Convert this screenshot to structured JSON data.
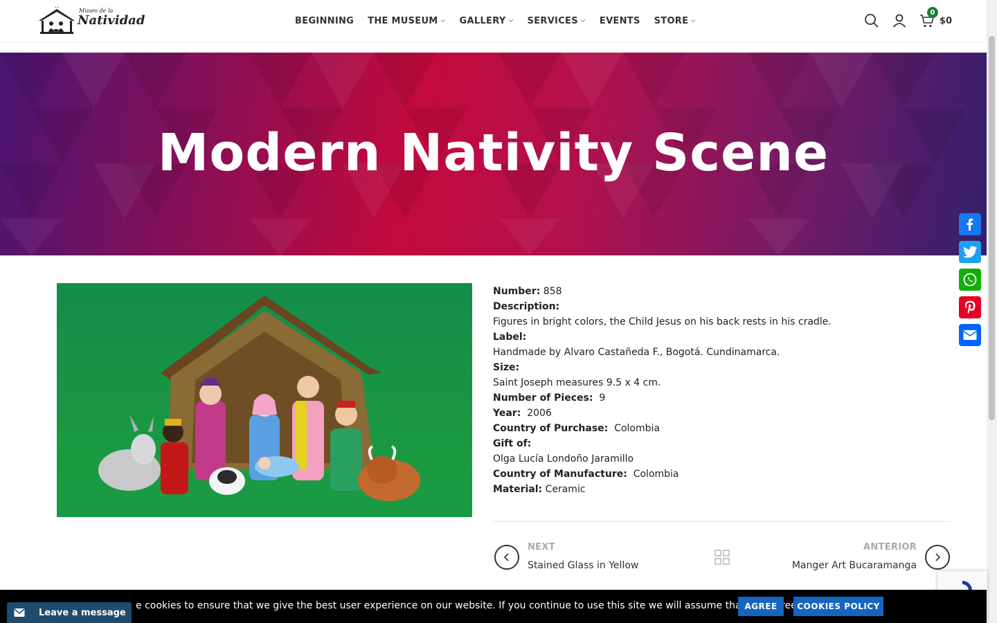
{
  "header": {
    "logo": {
      "small_text": "Museo de la",
      "big_text": "Natividad"
    },
    "nav": [
      {
        "label": "BEGINNING",
        "has_dropdown": false
      },
      {
        "label": "THE MUSEUM",
        "has_dropdown": true
      },
      {
        "label": "GALLERY",
        "has_dropdown": true
      },
      {
        "label": "SERVICES",
        "has_dropdown": true
      },
      {
        "label": "EVENTS",
        "has_dropdown": false
      },
      {
        "label": "STORE",
        "has_dropdown": true
      }
    ],
    "icons": [
      "search-icon",
      "user-icon",
      "cart-icon"
    ],
    "cart_count": "0",
    "cart_total": "$0"
  },
  "hero": {
    "title": "Modern Nativity Scene"
  },
  "details": {
    "number_label": "Number:",
    "number_value": "858",
    "description_label": "Description:",
    "description_value": "Figures in bright colors, the Child Jesus on his back rests in his cradle.",
    "label_label": "Label:",
    "label_value": "Handmade by Alvaro Castañeda F., Bogotá. Cundinamarca.",
    "size_label": "Size:",
    "size_value": "Saint Joseph measures 9.5 x 4 cm.",
    "pieces_label": "Number of Pieces:",
    "pieces_value": "9",
    "year_label": "Year:",
    "year_value": "2006",
    "purchase_label": "Country of Purchase:",
    "purchase_value": "Colombia",
    "gift_label": "Gift of:",
    "gift_value": "Olga Lucía Londoño Jaramillo",
    "manufacture_label": "Country of Manufacture:",
    "manufacture_value": "Colombia",
    "material_label": "Material:",
    "material_value": "Ceramic"
  },
  "post_nav": {
    "prev_label": "NEXT",
    "prev_title": "Stained Glass in Yellow",
    "next_label": "ANTERIOR",
    "next_title": "Manger Art Bucaramanga"
  },
  "share": [
    "facebook-icon",
    "twitter-icon",
    "whatsapp-icon",
    "pinterest-icon",
    "email-icon"
  ],
  "cookie": {
    "text": "e cookies to ensure that we give the best user experience on our website. If you continue to use this site we will assume that you agree.",
    "agree_label": "AGREE",
    "policy_label": "COOKIES POLICY"
  },
  "chat": {
    "label": "Leave a message"
  },
  "colors": {
    "accent_blue": "#1565c0",
    "cart_badge": "#1a7f37",
    "facebook": "#1877f2",
    "twitter": "#1da1f2",
    "whatsapp": "#12af0a",
    "pinterest": "#e60023",
    "email": "#0166ff"
  }
}
